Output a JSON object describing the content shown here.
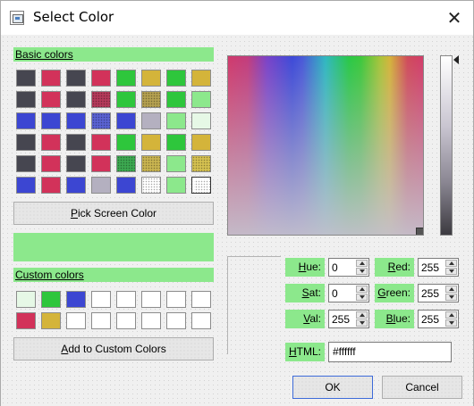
{
  "window": {
    "title": "Select Color",
    "close_glyph": "✕"
  },
  "basic_colors": {
    "label_first": "B",
    "label_rest": "asic colors",
    "rows": [
      [
        "#464650",
        "#d2325a",
        "#464650",
        "#d2325a",
        "#2ec63c",
        "#d4b43a",
        "#2ec63c",
        "#d4b43a"
      ],
      [
        "#464650",
        "#d2325a",
        "#464650",
        "#b43a5a",
        "#2ec63c",
        "#b4a050",
        "#2ec63c",
        "#8ce88c"
      ],
      [
        "#3c46d2",
        "#3c46d2",
        "#3c46d2",
        "#5a62d2",
        "#3c46d2",
        "#b4b0c0",
        "#8ce88c",
        "#e6f8e6"
      ],
      [
        "#464650",
        "#d2325a",
        "#464650",
        "#d2325a",
        "#2ec63c",
        "#d4b43a",
        "#2ec63c",
        "#d4b43a"
      ],
      [
        "#464650",
        "#d2325a",
        "#464650",
        "#d2325a",
        "#3ca850",
        "#c8b450",
        "#8ce88c",
        "#d4c050"
      ],
      [
        "#3c46d2",
        "#d2325a",
        "#3c46d2",
        "#b4b0c0",
        "#3c46d2",
        "#ffffff",
        "#8ce88c",
        "#ffffff"
      ]
    ]
  },
  "pick_screen_color": {
    "label_first": "P",
    "label_rest": "ick Screen Color"
  },
  "custom_colors": {
    "label_first": "C",
    "label_rest": "ustom colors",
    "rows": [
      [
        "#e6f8e6",
        "#2ec63c",
        "#3c46d2",
        "#ffffff",
        "#ffffff",
        "#ffffff",
        "#ffffff",
        "#ffffff"
      ],
      [
        "#d2325a",
        "#d4b43a",
        "#ffffff",
        "#ffffff",
        "#ffffff",
        "#ffffff",
        "#ffffff",
        "#ffffff"
      ]
    ]
  },
  "add_custom": {
    "label_first": "A",
    "label_rest": "dd to Custom Colors"
  },
  "preview_color": "#8ce88c",
  "fields": {
    "hue": {
      "label_first": "H",
      "label_rest": "ue:",
      "value": "0"
    },
    "sat": {
      "label_first": "S",
      "label_rest": "at:",
      "value": "0"
    },
    "val": {
      "label_first": "V",
      "label_rest": "al:",
      "value": "255"
    },
    "red": {
      "label_first": "R",
      "label_rest": "ed:",
      "value": "255"
    },
    "green": {
      "label_first": "G",
      "label_rest": "reen:",
      "value": "255"
    },
    "blue": {
      "label_first": "Bl",
      "label_rest": "ue:",
      "value": "255"
    },
    "html": {
      "label_first": "H",
      "label_rest": "TML:",
      "value": "#ffffff"
    }
  },
  "buttons": {
    "ok": "OK",
    "cancel": "Cancel"
  }
}
